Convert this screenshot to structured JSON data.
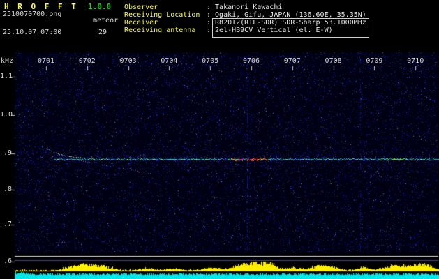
{
  "app": {
    "title": "H R O F F T",
    "version": "1.0.0",
    "filename": "2510070700.png",
    "mode_label": "meteor",
    "datetime": "25.10.07 07:00",
    "echo_count": "29"
  },
  "info": {
    "colon": ":",
    "rows": [
      {
        "label": "Observer",
        "value": "Takanori Kawachi"
      },
      {
        "label": "Receiving Location",
        "value": "Ogaki, Gifu, JAPAN (136.60E, 35.35N)"
      },
      {
        "label": "Receiver",
        "value": "R820T2(RTL-SDR) SDR-Sharp 53.1000MHz"
      },
      {
        "label": "Receiving antenna",
        "value": "2el-HB9CV Vertical (el. E-W)"
      }
    ]
  },
  "colors": {
    "title_yellow": "#ffff33",
    "version_green": "#22cc22",
    "text_white": "#d8d8d8",
    "plot_bg": "#000014",
    "noise_dim": "#101c8c",
    "noise_mid": "#2838d2",
    "noise_bright": "#5a78ff",
    "trace_cyan": "#19e0cf",
    "trace_green": "#23cc52",
    "trace_blue": "#4060ff",
    "echo_red": "#ff4022",
    "echo_orange": "#ff9922",
    "echo_yellow": "#ffe022",
    "echo_magenta": "#e040c0",
    "bright_green": "#35ff45",
    "head_echo_white": "#f2f2f2",
    "head_echo_pink": "#ff9898",
    "axis_tick": "#c8c8c8",
    "hline_white": "#dcdcff",
    "hline_blue": "#3a3ad8",
    "bar_yellow": "#ffee00",
    "bar_cyan": "#00e8e8"
  },
  "chart_data": {
    "type": "heatmap",
    "subtype": "radio_meteor_spectrogram",
    "title": "HROFFT 1.0.0 meteor radio spectrogram, 53.1000MHz, 25.10.07 07:00",
    "x_axis": {
      "unit": "time (hhmm)",
      "ticks": [
        "0701",
        "0702",
        "0703",
        "0704",
        "0705",
        "0706",
        "0707",
        "0708",
        "0709",
        "0710"
      ]
    },
    "y_axis": {
      "label": "kHz",
      "ticks": [
        "1.1",
        "1.0",
        ".9",
        ".8",
        ".7",
        ".6"
      ],
      "range_khz": [
        0.55,
        1.15
      ]
    },
    "carrier_trace_khz": 0.9,
    "meteor_echo_count": 29,
    "features": {
      "carrier": {
        "start_min": 1.2,
        "end_min": 10.56,
        "khz": 0.9,
        "desc": "continuous cyan/green carrier trace at about 0.9 kHz across the whole strip"
      },
      "head_echo": {
        "start_min": 1.0,
        "end_min": 2.15,
        "desc": "white/pink dotted head-echo curve descending onto the carrier near 0701"
      },
      "sub_trail": {
        "start_min": 1.8,
        "end_min": 3.55,
        "desc": "faint diagonal dotted trail drifting below the carrier between 0702 and 0703"
      },
      "strong_echo": {
        "start_min": 5.5,
        "end_min": 6.4,
        "desc": "strong red/orange/yellow/magenta echo burst around 0706"
      },
      "bright_echo": {
        "start_min": 9.15,
        "end_min": 9.8,
        "desc": "bright green echo segment near 0709-0710"
      },
      "vertical_streaks_min": [
        5.9,
        8.65
      ]
    },
    "signal_bursts_min": [
      {
        "min": 1.65,
        "w": 0.2,
        "amp": 5
      },
      {
        "min": 2.02,
        "w": 0.25,
        "amp": 10
      },
      {
        "min": 2.45,
        "w": 0.15,
        "amp": 5
      },
      {
        "min": 3.45,
        "w": 0.18,
        "amp": 3
      },
      {
        "min": 4.1,
        "w": 0.15,
        "amp": 3
      },
      {
        "min": 5.0,
        "w": 0.18,
        "amp": 4
      },
      {
        "min": 6.0,
        "w": 0.33,
        "amp": 13
      },
      {
        "min": 6.42,
        "w": 0.17,
        "amp": 8
      },
      {
        "min": 7.0,
        "w": 0.15,
        "amp": 4
      },
      {
        "min": 7.65,
        "w": 0.2,
        "amp": 7
      },
      {
        "min": 7.98,
        "w": 0.14,
        "amp": 5
      },
      {
        "min": 8.75,
        "w": 0.15,
        "amp": 4
      },
      {
        "min": 9.4,
        "w": 0.2,
        "amp": 7
      },
      {
        "min": 9.95,
        "w": 0.24,
        "amp": 10
      },
      {
        "min": 10.3,
        "w": 0.15,
        "amp": 6
      }
    ],
    "bottom_strip": {
      "yellow_series": "instantaneous signal-level bars; bursts near 0702, 0706, 0708 and 0710",
      "cyan_series": "continuous noise-floor band along the bottom edge"
    }
  }
}
